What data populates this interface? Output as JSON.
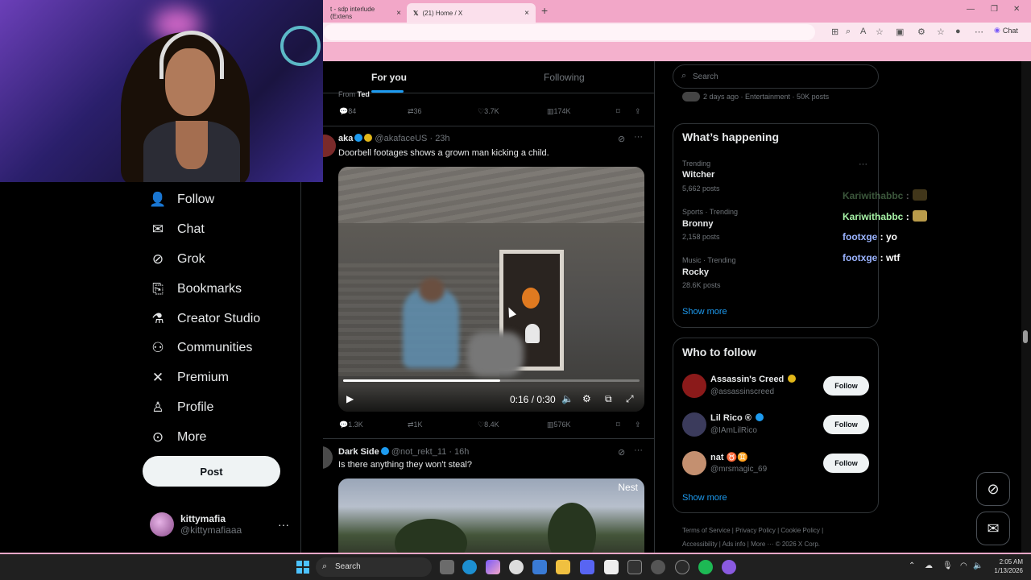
{
  "browser": {
    "tabs": [
      {
        "label": "t - sdp interlude (Extens",
        "close": "×"
      },
      {
        "label": "(21) Home / X",
        "close": "×"
      }
    ],
    "new_tab": "+",
    "chat_label": "Chat"
  },
  "nav": {
    "items": [
      {
        "label": "Follow",
        "icon": "follow-icon",
        "glyph": "⁺"
      },
      {
        "label": "Chat",
        "icon": "mail-icon",
        "glyph": "✉"
      },
      {
        "label": "Grok",
        "icon": "grok-icon",
        "glyph": "⊘"
      },
      {
        "label": "Bookmarks",
        "icon": "bookmark-icon",
        "glyph": "⌑"
      },
      {
        "label": "Creator Studio",
        "icon": "flask-icon",
        "glyph": "⚗"
      },
      {
        "label": "Communities",
        "icon": "communities-icon",
        "glyph": "👥"
      },
      {
        "label": "Premium",
        "icon": "x-icon",
        "glyph": "𝕏"
      },
      {
        "label": "Profile",
        "icon": "person-icon",
        "glyph": "◯"
      },
      {
        "label": "More",
        "icon": "more-circle-icon",
        "glyph": "⋯"
      }
    ],
    "post_label": "Post",
    "account": {
      "name": "kittymafia",
      "handle": "@kittymafiaaa",
      "more": "···"
    }
  },
  "feed": {
    "tabs": {
      "for_you": "For you",
      "following": "Following"
    },
    "prev_tweet": {
      "from_prefix": "From ",
      "from_name": "Ted",
      "replies": "84",
      "reposts": "36",
      "likes": "3.7K",
      "views": "174K"
    },
    "tweet1": {
      "name": "aka",
      "handle": "@akafaceUS",
      "time": "· 23h",
      "text": "Doorbell footages shows a grown man kicking a child.",
      "video_time": "0:16 / 0:30",
      "video_progress": 0.53,
      "replies": "1.3K",
      "reposts": "1K",
      "likes": "8.4K",
      "views": "576K"
    },
    "tweet2": {
      "name": "Dark Side",
      "handle": "@not_rekt_11",
      "time": "· 16h",
      "text": "Is there anything they won't steal?",
      "media_label": "Nest"
    }
  },
  "sidebar": {
    "search_placeholder": "Search",
    "top_meta": "2 days ago · Entertainment · 50K posts",
    "happening_title": "What’s happening",
    "trends": [
      {
        "meta": "Trending",
        "name": "Witcher",
        "count": "5,662 posts"
      },
      {
        "meta": "Sports · Trending",
        "name": "Bronny",
        "count": "2,158 posts"
      },
      {
        "meta": "Music · Trending",
        "name": "Rocky",
        "count": "28.6K posts"
      }
    ],
    "trend_more": "···",
    "show_more": "Show more",
    "wtf_title": "Who to follow",
    "who_to_follow": [
      {
        "name": "Assassin's Creed",
        "handle": "@assassinscreed",
        "button": "Follow"
      },
      {
        "name": "Lil Rico ®",
        "handle": "@IAmLilRico",
        "button": "Follow"
      },
      {
        "name": "nat ♉♊",
        "handle": "@mrsmagic_69",
        "button": "Follow"
      }
    ],
    "footer_line1": "Terms of Service  |  Privacy Policy  |  Cookie Policy  |",
    "footer_line2": "Accessibility  |  Ads info  |  More ···  © 2026 X Corp."
  },
  "chat_overlay": [
    {
      "user": "Kariwithabbc",
      "msg": " :"
    },
    {
      "user": "Kariwithabbc",
      "msg": " :"
    },
    {
      "user": "footxge",
      "msg": " : yo"
    },
    {
      "user": "footxge",
      "msg": " : wtf"
    }
  ],
  "taskbar": {
    "search_label": "Search",
    "time": "2:05 AM",
    "date": "1/13/2026"
  },
  "colors": {
    "accent": "#1d9bf0",
    "chrome_pink": "#f2a7c8",
    "chat_green": "#a7f3a7",
    "chat_blue": "#9ab3ff"
  }
}
